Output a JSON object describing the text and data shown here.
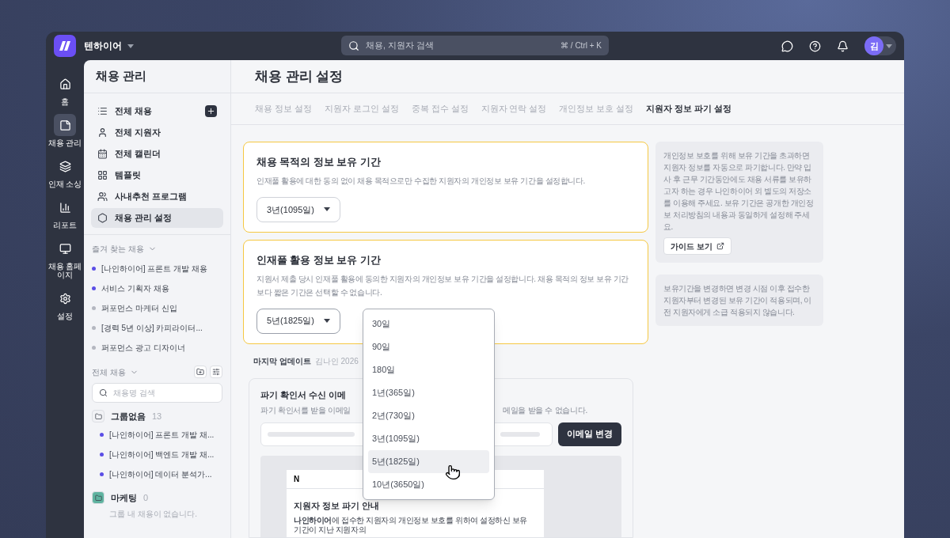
{
  "topbar": {
    "company": "텐하이어",
    "search": {
      "placeholder": "채용, 지원자 검색",
      "shortcut": "⌘ / Ctrl + K"
    },
    "avatar": "김"
  },
  "rail": [
    {
      "label": "홈",
      "selected": false
    },
    {
      "label": "채용 관리",
      "selected": true
    },
    {
      "label": "인재 소싱",
      "selected": false
    },
    {
      "label": "리포트",
      "selected": false
    },
    {
      "label": "채용 홈페이지",
      "selected": false
    },
    {
      "label": "설정",
      "selected": false
    }
  ],
  "sidebar": {
    "title": "채용 관리",
    "nav": [
      {
        "label": "전체 채용",
        "selected": false
      },
      {
        "label": "전체 지원자",
        "selected": false
      },
      {
        "label": "전체 캘린더",
        "selected": false
      },
      {
        "label": "템플릿",
        "selected": false
      },
      {
        "label": "사내추천 프로그램",
        "selected": false
      },
      {
        "label": "채용 관리 설정",
        "selected": true
      }
    ],
    "favorites": {
      "title": "즐겨 찾는 채용",
      "items": [
        {
          "label": "[나인하이어] 프론트 개발 채용",
          "color": "#5b4ee6"
        },
        {
          "label": "서비스 기획자 채용",
          "color": "#5b4ee6"
        },
        {
          "label": "퍼포먼스 마케터 신입",
          "color": "#b4b7c0"
        },
        {
          "label": "[경력 5년 이상] 카피라이터...",
          "color": "#b4b7c0"
        },
        {
          "label": "퍼포먼스 광고 디자이너",
          "color": "#b4b7c0"
        }
      ]
    },
    "all": {
      "title": "전체 채용",
      "search_placeholder": "채용명 검색",
      "groups": [
        {
          "name": "그룹없음",
          "count": "13",
          "color": "#f1f2f5",
          "items": [
            {
              "label": "[나인하이어] 프론트 개발 채...",
              "color": "#5b4ee6"
            },
            {
              "label": "[나인하이어] 백엔드 개발 채...",
              "color": "#5b4ee6"
            },
            {
              "label": "[나인하이어] 데이터 분석가...",
              "color": "#5b4ee6"
            }
          ]
        },
        {
          "name": "마케팅",
          "count": "0",
          "color": "#5fb3a0",
          "empty_text": "그룹 내 채용이 없습니다."
        }
      ]
    }
  },
  "page": {
    "title": "채용 관리 설정",
    "tabs": [
      {
        "label": "채용 정보 설정",
        "selected": false
      },
      {
        "label": "지원자 로그인 설정",
        "selected": false
      },
      {
        "label": "중복 접수 설정",
        "selected": false
      },
      {
        "label": "지원자 연락 설정",
        "selected": false
      },
      {
        "label": "개인정보 보호 설정",
        "selected": false
      },
      {
        "label": "지원자 정보 파기 설정",
        "selected": true
      }
    ]
  },
  "cards": [
    {
      "title": "채용 목적의 정보 보유 기간",
      "description": "인재풀 활용에 대한 동의 없이 채용 목적으로만 수집한 지원자의 개인정보 보유 기간을 설정합니다.",
      "select": {
        "value": "3년(1095일)",
        "expanded": false
      }
    },
    {
      "title": "인재풀 활용 정보 보유 기간",
      "description": "지원서 제출 당시 인재풀 활용에 동의한 지원자의 개인정보 보유 기간을 설정합니다. 채용 목적의 정보 보유 기간보다 짧은 기간은 선택할 수 없습니다.",
      "select": {
        "value": "5년(1825일)",
        "expanded": true,
        "options": [
          {
            "label": "30일",
            "selected": false
          },
          {
            "label": "90일",
            "selected": false
          },
          {
            "label": "180일",
            "selected": false
          },
          {
            "label": "1년(365일)",
            "selected": false
          },
          {
            "label": "2년(730일)",
            "selected": false
          },
          {
            "label": "3년(1095일)",
            "selected": false
          },
          {
            "label": "5년(1825일)",
            "selected": true
          },
          {
            "label": "10년(3650일)",
            "selected": false
          }
        ]
      }
    }
  ],
  "notes": [
    {
      "text": "개인정보 보호를 위해 보유 기간을 초과하면 지원자 정보를 자동으로 파기합니다. 만약 입사 후 근무 기간동안에도 채용 서류를 보유하고자 하는 경우 나인하이어 외 별도의 저장소를 이용해 주세요. 보유 기간은 공개한 개인정보 처리방침의 내용과 동일하게 설정해 주세요.",
      "link": "가이드 보기"
    },
    {
      "text": "보유기간을 변경하면 변경 시점 이후 접수한 지원자부터 변경된 보유 기간이 적용되며, 이전 지원자에게 소급 적용되지 않습니다."
    }
  ],
  "last_update": {
    "label": "마지막 업데이트",
    "value": "김나인 2026"
  },
  "email_card": {
    "title": "파기 확인서 수신 이메",
    "description_start": "파기 확인서를 받을 이메일",
    "description_end": "메일을 받을 수 없습니다.",
    "button": "이메일 변경"
  },
  "preview": {
    "logo": "N",
    "title": "지원자 정보 파기 안내",
    "body": "**나인하이어**에 접수한 지원자의 개인정보 보호를 위하여 설정하신 보유 기간이 지난 지원자의"
  }
}
